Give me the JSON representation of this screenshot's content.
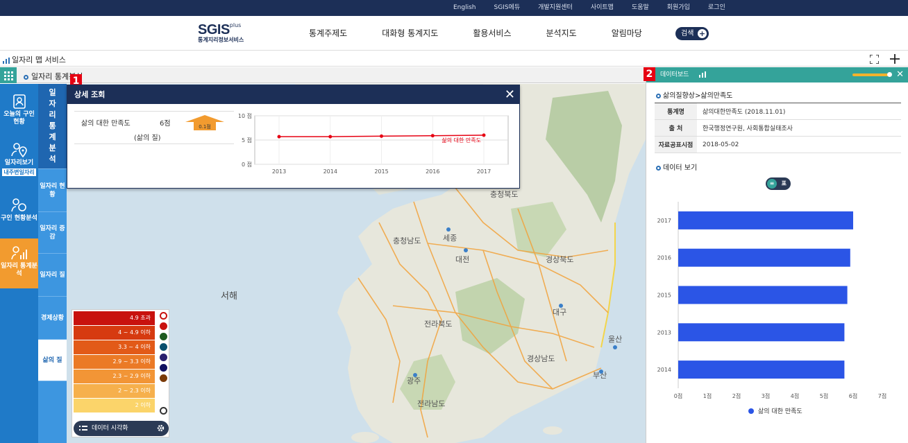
{
  "util_links": [
    "English",
    "SGIS에듀",
    "개발지원센터",
    "사이트맵",
    "도움말",
    "회원가입",
    "로그인"
  ],
  "logo": {
    "main": "SGIS",
    "plus": "plus",
    "sub": "통계지리정보서비스"
  },
  "gnb": [
    "통계주제도",
    "대화형 통계지도",
    "활용서비스",
    "분석지도",
    "알림마당"
  ],
  "search_label": "검색",
  "service_title": "일자리 맵 서비스",
  "map_bar_label": "일자리 통계분석",
  "left_nav": [
    {
      "label": "오늘의 구인 현황"
    },
    {
      "label": "일자리보기",
      "tag": "내주변일자리"
    },
    {
      "label": "구인 현황분석"
    },
    {
      "label": "일자리 통계분석"
    }
  ],
  "sub_nav": [
    "일자리통계분석",
    "일자리 현황",
    "일자리 증감",
    "일자리 질",
    "경제상황",
    "삶의 질"
  ],
  "detail": {
    "title": "상세 조회",
    "indicator": "삶의 대한 만족도",
    "value": "6점",
    "category": "(삶의 질)",
    "change": "0.1점",
    "chart": {
      "type": "line",
      "x": [
        "2013",
        "2014",
        "2015",
        "2016",
        "2017"
      ],
      "series": [
        {
          "name": "삶의 대한 만족도",
          "values": [
            5.7,
            5.7,
            5.8,
            5.9,
            6.0
          ]
        }
      ],
      "ylim": [
        0,
        10
      ],
      "yticks": [
        "10 점",
        "5 점",
        "0 점"
      ],
      "series_color": "#e60012"
    }
  },
  "map_labels": {
    "seohae": "서해",
    "cities": [
      "충청북도",
      "충청남도",
      "세종",
      "대전",
      "경상북도",
      "대구",
      "전라북도",
      "경상남도",
      "울산",
      "부산",
      "광주",
      "전라남도"
    ]
  },
  "legend": {
    "bands": [
      {
        "label": "4.9 초과",
        "color": "#c8120e"
      },
      {
        "label": "4 ~ 4.9 이하",
        "color": "#d63a10"
      },
      {
        "label": "3.3 ~ 4 이하",
        "color": "#e25a18"
      },
      {
        "label": "2.9 ~ 3.3 이하",
        "color": "#eb7a26"
      },
      {
        "label": "2.3 ~ 2.9 이하",
        "color": "#f29536"
      },
      {
        "label": "2 ~ 2.3 이하",
        "color": "#f6b04c"
      },
      {
        "label": "2 이하",
        "color": "#fbd46a"
      }
    ],
    "swatches": [
      "#c8120e",
      "#1f5a1f",
      "#0a4f6e",
      "#2a1f6e",
      "#101060",
      "#7a3a08"
    ],
    "viz_label": "데이터 시각화"
  },
  "dashboard": {
    "title": "데이터보드",
    "breadcrumb": "삶의질향상>삶의만족도",
    "info": [
      {
        "k": "통계명",
        "v": "삶의대한만족도 (2018.11.01)"
      },
      {
        "k": "출 처",
        "v": "한국행정연구원, 사회통합실태조사"
      },
      {
        "k": "자료공표시점",
        "v": "2018-05-02"
      }
    ],
    "data_view": "데이터 보기",
    "toggle_off": "표"
  },
  "chart_data": {
    "type": "bar",
    "orientation": "horizontal",
    "categories": [
      "2017",
      "2016",
      "2015",
      "2013",
      "2014"
    ],
    "series": [
      {
        "name": "삶의 대한 만족도",
        "values": [
          6.0,
          5.9,
          5.8,
          5.7,
          5.7
        ]
      }
    ],
    "xlim": [
      0,
      7
    ],
    "xticks": [
      "0점",
      "1점",
      "2점",
      "3점",
      "4점",
      "5점",
      "6점",
      "7점"
    ],
    "legend": "bottom",
    "bar_color": "#2b55e6"
  }
}
